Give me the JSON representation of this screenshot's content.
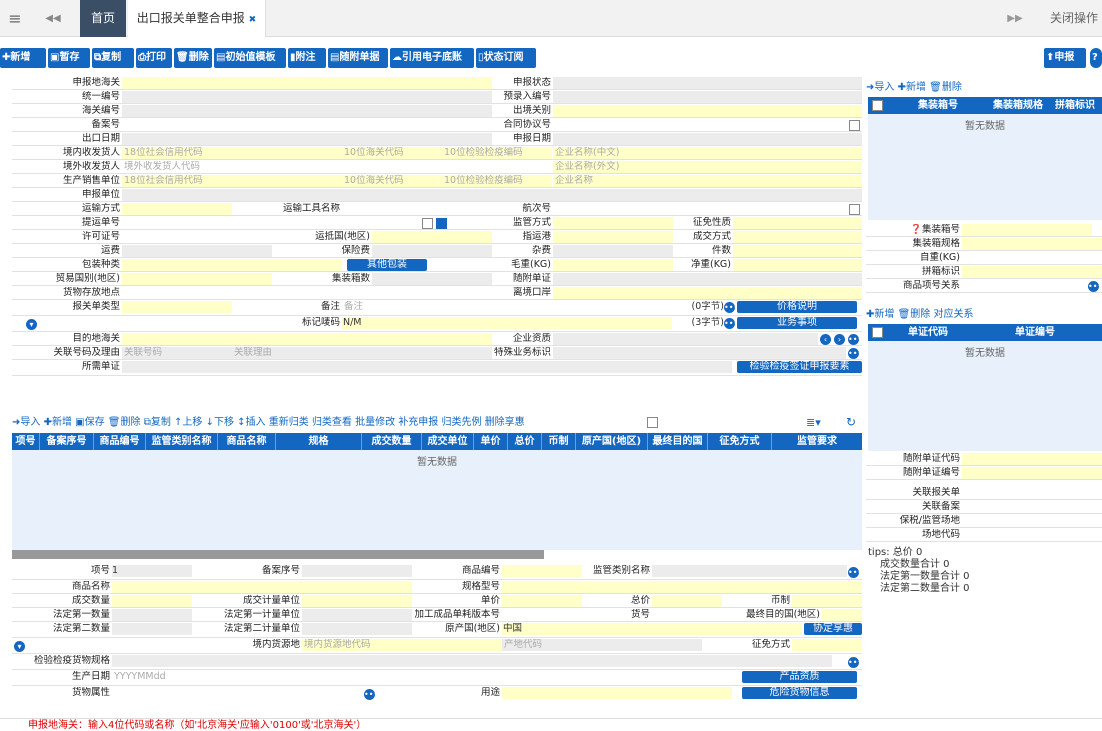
{
  "top": {
    "menu_icon": "≡",
    "back_icon": "◀◀",
    "tab_home": "首页",
    "tab_active": "出口报关单整合申报",
    "close_icon": "✖",
    "fwd_icon": "▶▶",
    "close_ops": "关闭操作"
  },
  "toolbar": {
    "new": "新增",
    "draft": "暂存",
    "copy": "复制",
    "print": "打印",
    "delete": "删除",
    "init_tpl": "初始值模板",
    "attach": "附注",
    "docs": "随附单据",
    "e_ledger": "引用电子底账",
    "sub": "状态订阅",
    "declare": "申报"
  },
  "form": {
    "l_customs": "申报地海关",
    "l_status": "申报状态",
    "l_uscc": "统一编号",
    "l_preentry": "预录入编号",
    "l_customs_no": "海关编号",
    "l_exit": "出境关别",
    "l_record": "备案号",
    "l_contract": "合同协议号",
    "l_exp_date": "出口日期",
    "l_decl_date": "申报日期",
    "l_consignee": "境内收发货人",
    "ph_credit": "18位社会信用代码",
    "ph_10customs": "10位海关代码",
    "ph_10insp": "10位检验检疫编码",
    "ph_cn_name": "企业名称(中文)",
    "l_overseas": "境外收发货人",
    "ph_overseas": "境外收发货人代码",
    "ph_en_name": "企业名称(外文)",
    "l_producer": "生产销售单位",
    "ph_name": "企业名称",
    "l_agent": "申报单位",
    "l_transport": "运输方式",
    "l_vehicle": "运输工具名称",
    "l_voyage": "航次号",
    "l_bl": "提运单号",
    "l_supervise": "监管方式",
    "l_tax": "征免性质",
    "l_license": "许可证号",
    "l_dest_country": "运抵国(地区)",
    "l_port": "指运港",
    "l_trans_mode": "成交方式",
    "l_freight": "运费",
    "l_insurance": "保险费",
    "l_misc": "杂费",
    "l_pieces": "件数",
    "l_pack": "包装种类",
    "b_other_pack": "其他包装",
    "l_gross": "毛重(KG)",
    "l_net": "净重(KG)",
    "l_trade_country": "贸易国别(地区)",
    "l_containers": "集装箱数",
    "l_attached": "随附单证",
    "l_storage": "货物存放地点",
    "l_leave_port": "离境口岸",
    "l_type": "报关单类型",
    "l_remark": "备注",
    "ph_remark": "备注",
    "bytes0": "(0字节)",
    "b_price": "价格说明",
    "l_marks": "标记唛码",
    "v_marks": "N/M",
    "bytes3": "(3字节)",
    "b_business": "业务事项",
    "l_dest_customs": "目的地海关",
    "l_qual": "企业资质",
    "l_rel": "关联号码及理由",
    "ph_rel_no": "关联号码",
    "ph_rel_reason": "关联理由",
    "l_special": "特殊业务标识",
    "l_need_cert": "所需单证",
    "b_insp_req": "检验检疫签证申报要素"
  },
  "goods_toolbar": [
    "导入",
    "新增",
    "保存",
    "删除",
    "复制",
    "上移",
    "下移",
    "插入",
    "重新归类",
    "归类查看",
    "批量修改",
    "补充申报",
    "归类先例",
    "删除享惠"
  ],
  "goods_cols": [
    "项号",
    "备案序号",
    "商品编号",
    "监管类别名称",
    "商品名称",
    "规格",
    "成交数量",
    "成交单位",
    "单价",
    "总价",
    "币制",
    "原产国(地区)",
    "最终目的国",
    "征免方式",
    "监管要求"
  ],
  "no_data": "暂无数据",
  "item": {
    "l_no": "项号",
    "v_no": "1",
    "l_rec_seq": "备案序号",
    "l_code": "商品编号",
    "l_sup_cat": "监管类别名称",
    "l_name": "商品名称",
    "l_spec": "规格型号",
    "l_qty": "成交数量",
    "l_unit": "成交计量单位",
    "l_price": "单价",
    "l_total": "总价",
    "l_cur": "币制",
    "l_q1": "法定第一数量",
    "l_u1": "法定第一计量单位",
    "l_consume": "加工成品单耗版本号",
    "l_goods_no": "货号",
    "l_final": "最终目的国(地区)",
    "l_q2": "法定第二数量",
    "l_u2": "法定第二计量单位",
    "l_origin": "原产国(地区)",
    "v_origin": "中国",
    "b_agree": "协定享惠",
    "l_source": "境内货源地",
    "ph_source": "境内货源地代码",
    "ph_place": "产地代码",
    "l_levy": "征免方式",
    "l_insp_spec": "检验检疫货物规格",
    "l_prod_date": "生产日期",
    "ph_date": "YYYYMMdd",
    "b_prod_qual": "产品资质",
    "l_attr": "货物属性",
    "l_use": "用途",
    "b_danger": "危险货物信息"
  },
  "footer_tip": "申报地海关：输入4位代码或名称（如'北京海关'应输入'0100'或'北京海关'）",
  "right": {
    "top_actions": [
      "导入",
      "新增",
      "删除"
    ],
    "cont_cols": [
      "集装箱号",
      "集装箱规格",
      "拼箱标识"
    ],
    "l_cont_no": "集装箱号",
    "l_cont_spec": "集装箱规格",
    "l_self_wt": "自重(KG)",
    "l_lcl": "拼箱标识",
    "l_item_rel": "商品项号关系",
    "doc_actions": [
      "新增",
      "删除",
      "对应关系"
    ],
    "doc_cols": [
      "单证代码",
      "单证编号"
    ],
    "l_doc_code": "随附单证代码",
    "l_doc_no": "随附单证编号",
    "l_rel_decl": "关联报关单",
    "l_rel_rec": "关联备案",
    "l_bonded": "保税/监管场地",
    "l_site": "场地代码",
    "tips": [
      "tips: 总价 0",
      "成交数量合计 0",
      "法定第一数量合计 0",
      "法定第二数量合计 0"
    ]
  }
}
